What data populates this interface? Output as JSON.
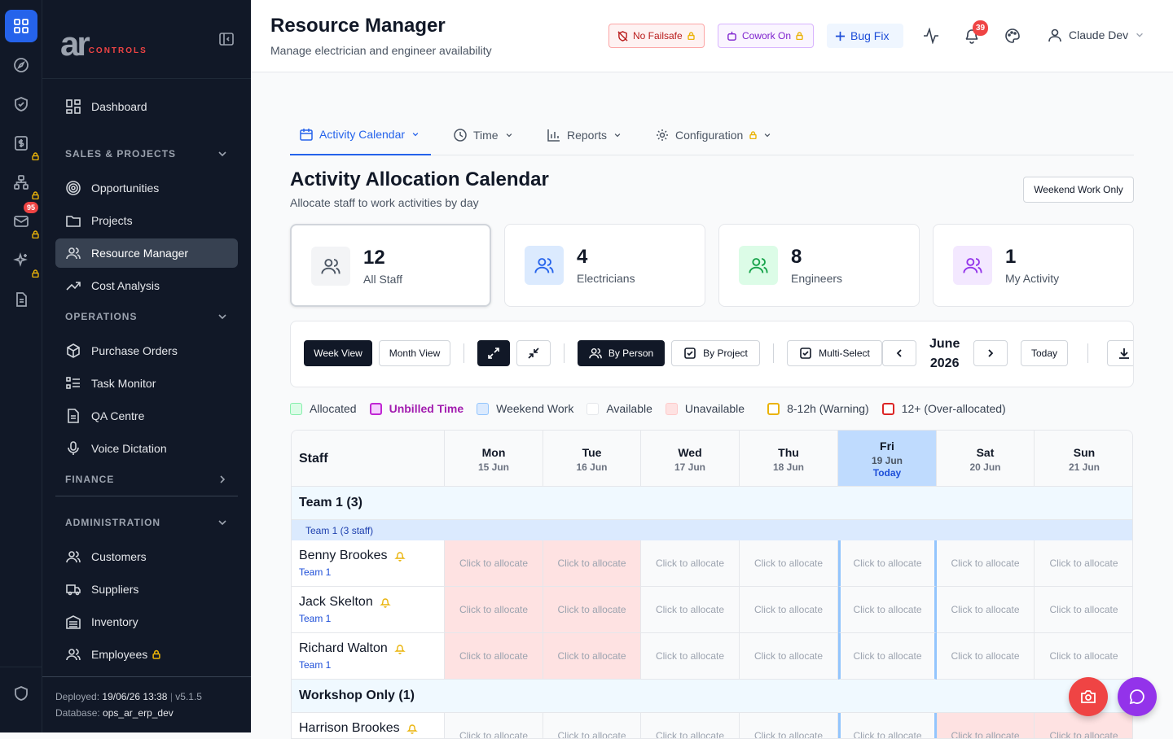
{
  "rail": {
    "mail_badge": "95"
  },
  "sidebar": {
    "logo_main": "ar",
    "logo_sub": "CONTROLS",
    "items": {
      "dashboard": "Dashboard",
      "opportunities": "Opportunities",
      "projects": "Projects",
      "resource_manager": "Resource Manager",
      "cost_analysis": "Cost Analysis",
      "purchase_orders": "Purchase Orders",
      "task_monitor": "Task Monitor",
      "qa_centre": "QA Centre",
      "voice_dictation": "Voice Dictation",
      "customers": "Customers",
      "suppliers": "Suppliers",
      "inventory": "Inventory",
      "employees": "Employees"
    },
    "sections": {
      "sales": "SALES & PROJECTS",
      "operations": "OPERATIONS",
      "finance": "FINANCE",
      "administration": "ADMINISTRATION"
    },
    "footer": {
      "deployed_label": "Deployed:",
      "deployed_value": "19/06/26 13:38",
      "version": "v5.1.5",
      "database_label": "Database:",
      "database_value": "ops_ar_erp_dev"
    }
  },
  "header": {
    "title": "Resource Manager",
    "subtitle": "Manage electrician and engineer availability",
    "no_failsafe": "No Failsafe",
    "cowork": "Cowork On",
    "bug_fix": "Bug Fix",
    "notifications": "39",
    "user": "Claude Dev"
  },
  "tabs": [
    "Activity Calendar",
    "Time",
    "Reports",
    "Configuration"
  ],
  "calendar": {
    "title": "Activity Allocation Calendar",
    "subtitle": "Allocate staff to work activities by day",
    "weekend_btn": "Weekend Work Only"
  },
  "stats": [
    {
      "num": "12",
      "label": "All Staff"
    },
    {
      "num": "4",
      "label": "Electricians"
    },
    {
      "num": "8",
      "label": "Engineers"
    },
    {
      "num": "1",
      "label": "My Activity"
    }
  ],
  "toolbar": {
    "week_view": "Week View",
    "month_view": "Month View",
    "by_person": "By Person",
    "by_project": "By Project",
    "multi_select": "Multi-Select",
    "month": "June",
    "year": "2026",
    "today": "Today"
  },
  "legend": {
    "allocated": "Allocated",
    "unbilled": "Unbilled Time",
    "weekend": "Weekend Work",
    "available": "Available",
    "unavailable": "Unavailable",
    "warning": "8-12h (Warning)",
    "over": "12+ (Over-allocated)"
  },
  "grid": {
    "staff_header": "Staff",
    "days": [
      {
        "day": "Mon",
        "date": "15 Jun"
      },
      {
        "day": "Tue",
        "date": "16 Jun"
      },
      {
        "day": "Wed",
        "date": "17 Jun"
      },
      {
        "day": "Thu",
        "date": "18 Jun"
      },
      {
        "day": "Fri",
        "date": "19 Jun",
        "today": "Today"
      },
      {
        "day": "Sat",
        "date": "20 Jun"
      },
      {
        "day": "Sun",
        "date": "21 Jun"
      }
    ],
    "cell_text": "Click to allocate",
    "team1": "Team 1 (3)",
    "team1_sub": "Team 1 (3 staff)",
    "team2": "Workshop Only (1)",
    "staff": [
      {
        "name": "Benny Brookes",
        "team": "Team 1"
      },
      {
        "name": "Jack Skelton",
        "team": "Team 1"
      },
      {
        "name": "Richard Walton",
        "team": "Team 1"
      },
      {
        "name": "Harrison Brookes",
        "team": ""
      }
    ]
  }
}
